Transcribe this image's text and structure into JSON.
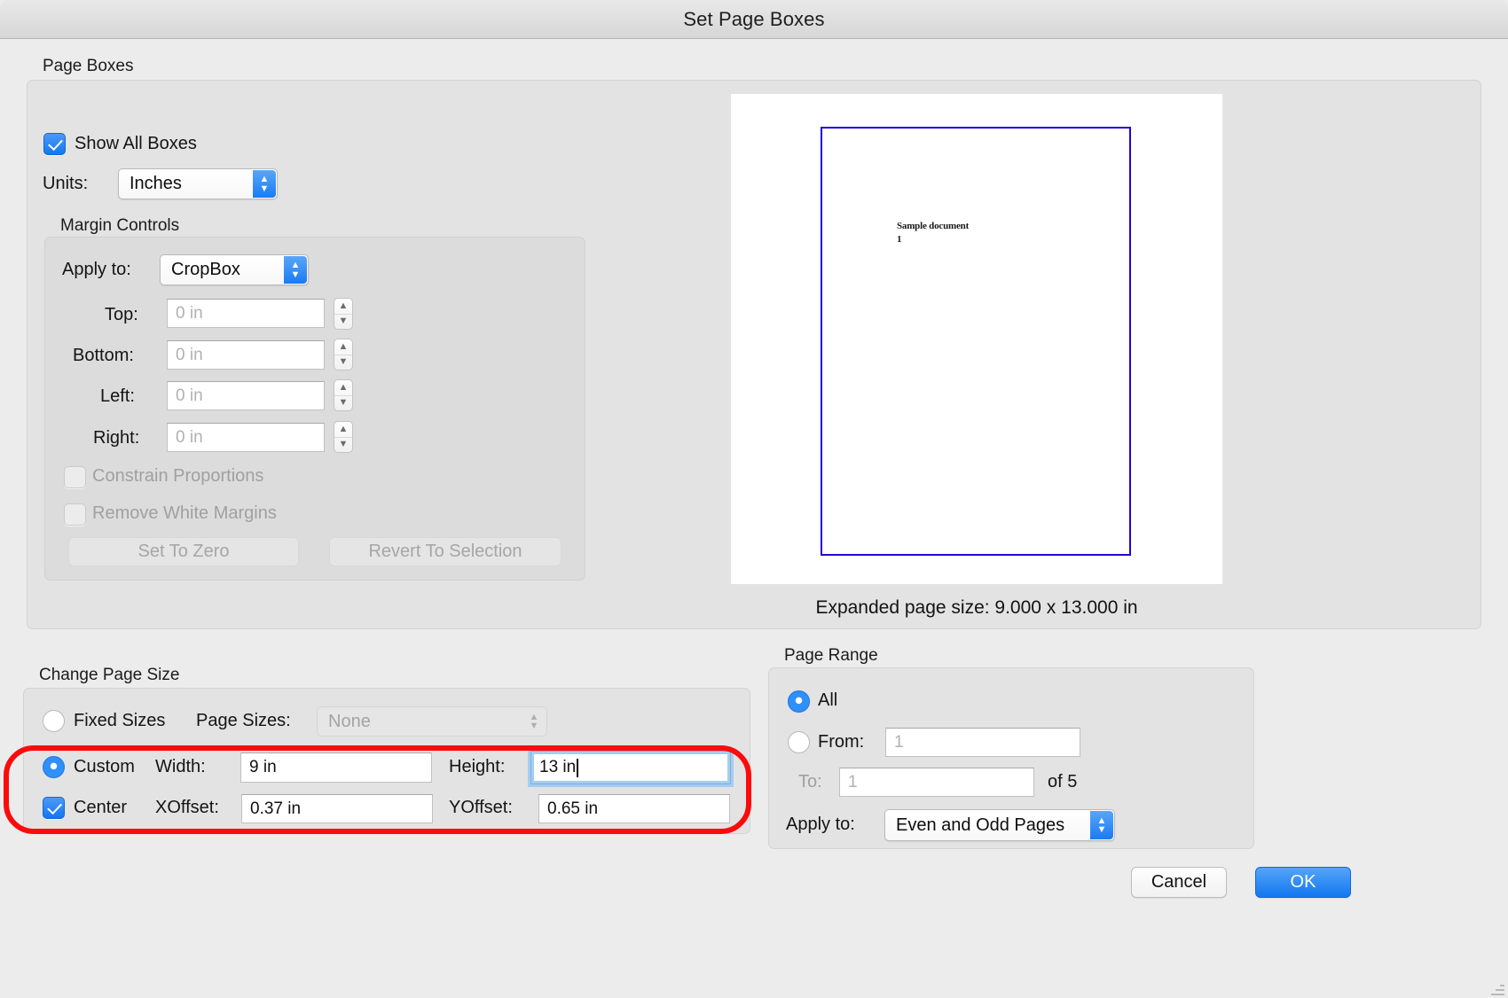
{
  "window": {
    "title": "Set Page Boxes"
  },
  "page_boxes": {
    "section_label": "Page Boxes",
    "show_all_boxes": {
      "label": "Show All Boxes",
      "checked": true
    },
    "units": {
      "label": "Units:",
      "value": "Inches"
    },
    "margin_controls": {
      "section_label": "Margin Controls",
      "apply_to": {
        "label": "Apply to:",
        "value": "CropBox"
      },
      "fields": [
        {
          "label": "Top:",
          "value": "",
          "placeholder": "0 in"
        },
        {
          "label": "Bottom:",
          "value": "",
          "placeholder": "0 in"
        },
        {
          "label": "Left:",
          "value": "",
          "placeholder": "0 in"
        },
        {
          "label": "Right:",
          "value": "",
          "placeholder": "0 in"
        }
      ],
      "constrain_proportions": {
        "label": "Constrain Proportions",
        "checked": false,
        "enabled": false
      },
      "remove_white_margins": {
        "label": "Remove White Margins",
        "checked": false,
        "enabled": false
      },
      "set_to_zero": {
        "label": "Set To Zero",
        "enabled": false
      },
      "revert_to_selection": {
        "label": "Revert To Selection",
        "enabled": false
      }
    },
    "preview": {
      "doc_line1": "Sample document",
      "doc_line2": "1",
      "box_color": "#2200dd",
      "expanded_note": "Expanded page size: 9.000 x 13.000 in"
    }
  },
  "change_page_size": {
    "section_label": "Change Page Size",
    "fixed_sizes": {
      "label": "Fixed Sizes",
      "selected": false
    },
    "page_sizes": {
      "label": "Page Sizes:",
      "value": "None",
      "enabled": false
    },
    "custom": {
      "label": "Custom",
      "selected": true
    },
    "width": {
      "label": "Width:",
      "value": "9 in"
    },
    "height": {
      "label": "Height:",
      "value": "13 in",
      "focused": true
    },
    "center": {
      "label": "Center",
      "checked": true
    },
    "xoffset": {
      "label": "XOffset:",
      "value": "0.37 in"
    },
    "yoffset": {
      "label": "YOffset:",
      "value": "0.65 in"
    },
    "highlight_color": "#fb0b0b"
  },
  "page_range": {
    "section_label": "Page Range",
    "all": {
      "label": "All",
      "selected": true
    },
    "from": {
      "label": "From:",
      "value": "",
      "placeholder": "1",
      "selected": false
    },
    "to": {
      "label": "To:",
      "value": "",
      "placeholder": "1"
    },
    "of_total": {
      "label": "of 5"
    },
    "apply_to": {
      "label": "Apply to:",
      "value": "Even and Odd Pages"
    }
  },
  "footer": {
    "cancel": "Cancel",
    "ok": "OK"
  }
}
